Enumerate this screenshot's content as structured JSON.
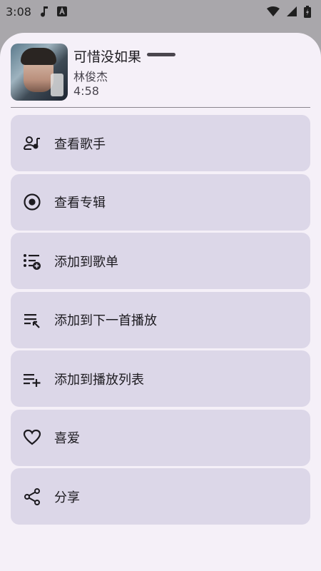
{
  "status_bar": {
    "time": "3:08",
    "icons": [
      "music-note-icon",
      "a-app-icon",
      "wifi-icon",
      "battery-icon"
    ]
  },
  "song": {
    "title": "可惜没如果",
    "artist": "林俊杰",
    "duration": "4:58"
  },
  "menu": {
    "items": [
      {
        "label": "查看歌手",
        "icon": "artist-icon"
      },
      {
        "label": "查看专辑",
        "icon": "album-icon"
      },
      {
        "label": "添加到歌单",
        "icon": "playlist-add-icon"
      },
      {
        "label": "添加到下一首播放",
        "icon": "play-next-icon"
      },
      {
        "label": "添加到播放列表",
        "icon": "queue-add-icon"
      },
      {
        "label": "喜爱",
        "icon": "heart-icon"
      },
      {
        "label": "分享",
        "icon": "share-icon"
      }
    ]
  },
  "colors": {
    "sheet_bg": "#f5f0f8",
    "item_bg": "#dcd7e8",
    "scrim": "#a9a7ab",
    "text_primary": "#1d1b20",
    "text_secondary": "#49454f"
  }
}
